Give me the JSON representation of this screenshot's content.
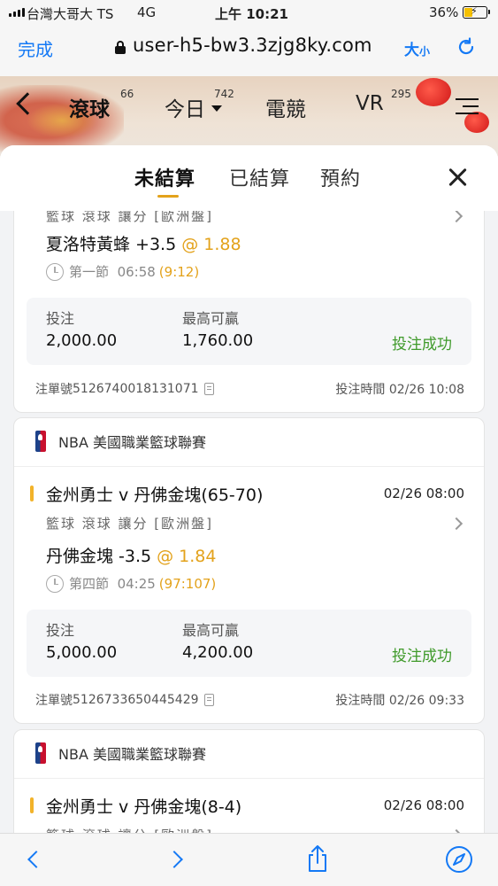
{
  "status_bar": {
    "carrier": "台灣大哥大 TS",
    "network": "4G",
    "time": "上午 10:21",
    "battery": "36%"
  },
  "browser": {
    "done_label": "完成",
    "url": "user-h5-bw3.3zjg8ky.com",
    "text_size_big": "大",
    "text_size_small": "小"
  },
  "nav": {
    "items": [
      {
        "label": "滾球",
        "count": "66"
      },
      {
        "label": "今日",
        "count": "742"
      },
      {
        "label": "電競",
        "count": ""
      },
      {
        "label": "VR",
        "count": "295"
      }
    ]
  },
  "sheet": {
    "tabs": [
      "未結算",
      "已結算",
      "預約"
    ],
    "active_tab": 0
  },
  "labels": {
    "stake": "投注",
    "max_win": "最高可贏",
    "ticket_prefix": "注單號",
    "bet_time_prefix": "投注時間"
  },
  "bets": [
    {
      "bet_type": "籃球  滾球  讓分 [歐洲盤]",
      "pick": "夏洛特黃蜂 +3.5",
      "odds": "@ 1.88",
      "period": "第一節",
      "clock": "06:58",
      "score": "(9:12)",
      "stake": "2,000.00",
      "max_win": "1,760.00",
      "status": "投注成功",
      "ticket_no": "5126740018131071",
      "bet_time": "02/26 10:08"
    },
    {
      "league": "NBA 美國職業籃球聯賽",
      "match": "金州勇士 v 丹佛金塊(65-70)",
      "match_time": "02/26 08:00",
      "bet_type": "籃球  滾球  讓分 [歐洲盤]",
      "pick": "丹佛金塊 -3.5",
      "odds": "@ 1.84",
      "period": "第四節",
      "clock": "04:25",
      "score": "(97:107)",
      "stake": "5,000.00",
      "max_win": "4,200.00",
      "status": "投注成功",
      "ticket_no": "5126733650445429",
      "bet_time": "02/26 09:33"
    },
    {
      "league": "NBA 美國職業籃球聯賽",
      "match": "金州勇士 v 丹佛金塊(8-4)",
      "match_time": "02/26 08:00",
      "bet_type": "籃球  滾球  讓分 [歐洲盤]"
    }
  ]
}
